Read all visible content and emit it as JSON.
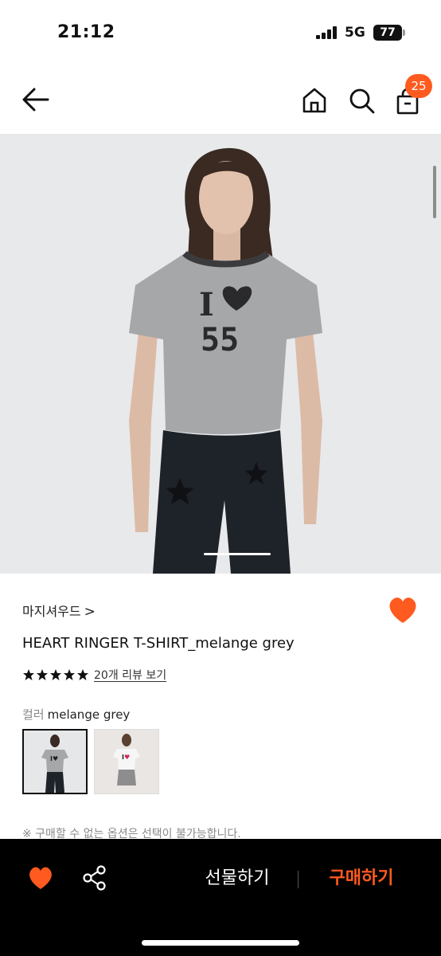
{
  "status_bar": {
    "time": "21:12",
    "network": "5G",
    "battery": "77"
  },
  "header": {
    "back_icon": "arrow-left-icon",
    "home_icon": "home-icon",
    "search_icon": "search-icon",
    "bag_icon": "shopping-bag-icon",
    "cart_count": "25"
  },
  "product": {
    "brand": "마지셔우드",
    "brand_chevron": ">",
    "title": "HEART RINGER T-SHIRT_melange grey",
    "rating_stars": 5,
    "review_link": "20개 리뷰 보기",
    "color_label": "컬러",
    "color_value": "melange grey",
    "swatches": [
      "melange grey",
      "white"
    ],
    "notice": "※ 구매할 수 없는 옵션은 선택이 불가능합니다."
  },
  "bottom_bar": {
    "gift_label": "선물하기",
    "buy_label": "구매하기"
  },
  "colors": {
    "accent": "#ff5a1f",
    "bottom_bar_bg": "#000000",
    "image_bg": "#e8e9eb"
  }
}
